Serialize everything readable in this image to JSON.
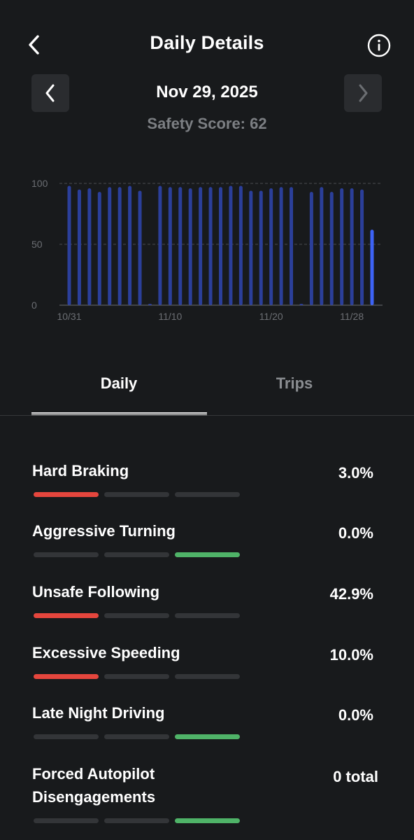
{
  "header": {
    "title": "Daily Details"
  },
  "date_nav": {
    "date": "Nov 29, 2025",
    "safety_score_text": "Safety Score: 62"
  },
  "chart_data": {
    "type": "bar",
    "y_ticks": [
      "100",
      "50",
      "0"
    ],
    "ylim": [
      0,
      100
    ],
    "x_tick_labels": [
      {
        "label": "10/31",
        "index": 0
      },
      {
        "label": "11/10",
        "index": 10
      },
      {
        "label": "11/20",
        "index": 20
      },
      {
        "label": "11/28",
        "index": 28
      }
    ],
    "categories": [
      "10/31",
      "11/1",
      "11/2",
      "11/3",
      "11/4",
      "11/5",
      "11/6",
      "11/7",
      "11/8",
      "11/9",
      "11/10",
      "11/11",
      "11/12",
      "11/13",
      "11/14",
      "11/15",
      "11/16",
      "11/17",
      "11/18",
      "11/19",
      "11/20",
      "11/21",
      "11/22",
      "11/23",
      "11/24",
      "11/25",
      "11/26",
      "11/27",
      "11/28",
      "11/29"
    ],
    "values": [
      98,
      95,
      96,
      93,
      97,
      97,
      98,
      94,
      1,
      98,
      97,
      97,
      96,
      97,
      97,
      97,
      98,
      98,
      94,
      94,
      96,
      97,
      97,
      1,
      93,
      97,
      93,
      96,
      96,
      95,
      62
    ],
    "highlight_index": 30,
    "colors": {
      "bar": "#2b3f9a",
      "highlight": "#3d63f5",
      "grid": "#4a4c50",
      "axis": "#6a6d72",
      "tick_text": "#6b6e73"
    }
  },
  "tabs": [
    {
      "label": "Daily",
      "active": true
    },
    {
      "label": "Trips",
      "active": false
    }
  ],
  "metrics": [
    {
      "label": "Hard Braking",
      "value": "3.0%",
      "level": "red"
    },
    {
      "label": "Aggressive Turning",
      "value": "0.0%",
      "level": "green"
    },
    {
      "label": "Unsafe Following",
      "value": "42.9%",
      "level": "red"
    },
    {
      "label": "Excessive Speeding",
      "value": "10.0%",
      "level": "red"
    },
    {
      "label": "Late Night Driving",
      "value": "0.0%",
      "level": "green"
    },
    {
      "label": "Forced Autopilot Disengagements",
      "value": "0 total",
      "level": "green"
    }
  ],
  "icons": {
    "back": "chevron-left-icon",
    "info": "info-circle-icon",
    "prev": "chevron-left-icon",
    "next": "chevron-right-icon"
  }
}
